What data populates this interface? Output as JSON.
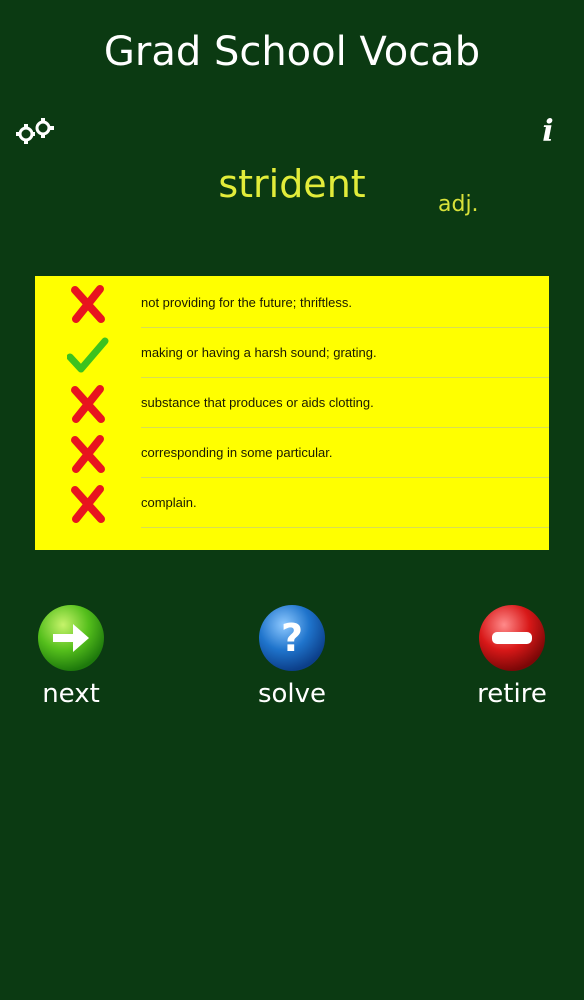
{
  "app": {
    "title": "Grad School Vocab"
  },
  "icons": {
    "settings": "gears-icon",
    "info": "info-icon"
  },
  "info_label": "i",
  "card": {
    "word": "strident",
    "part_of_speech": "adj."
  },
  "choices": [
    {
      "text": "not providing for the future; thriftless.",
      "result": "incorrect",
      "icon": "red-x-icon"
    },
    {
      "text": "making or having a harsh sound; grating.",
      "result": "correct",
      "icon": "green-check-icon"
    },
    {
      "text": "substance that produces or aids clotting.",
      "result": "incorrect",
      "icon": "red-x-icon"
    },
    {
      "text": "corresponding in some particular.",
      "result": "incorrect",
      "icon": "red-x-icon"
    },
    {
      "text": "complain.",
      "result": "incorrect",
      "icon": "red-x-icon"
    }
  ],
  "actions": {
    "next": {
      "label": "next",
      "icon": "green-arrow-icon",
      "color": "#4cb81a"
    },
    "solve": {
      "label": "solve",
      "icon": "blue-question-icon",
      "color": "#1b6fc9"
    },
    "retire": {
      "label": "retire",
      "icon": "red-minus-icon",
      "color": "#d01818"
    }
  },
  "colors": {
    "background": "#0b3a12",
    "word": "#e2ec3a",
    "choices_panel": "#ffff00",
    "incorrect_mark": "#e8141e",
    "correct_mark": "#3cc21e"
  }
}
